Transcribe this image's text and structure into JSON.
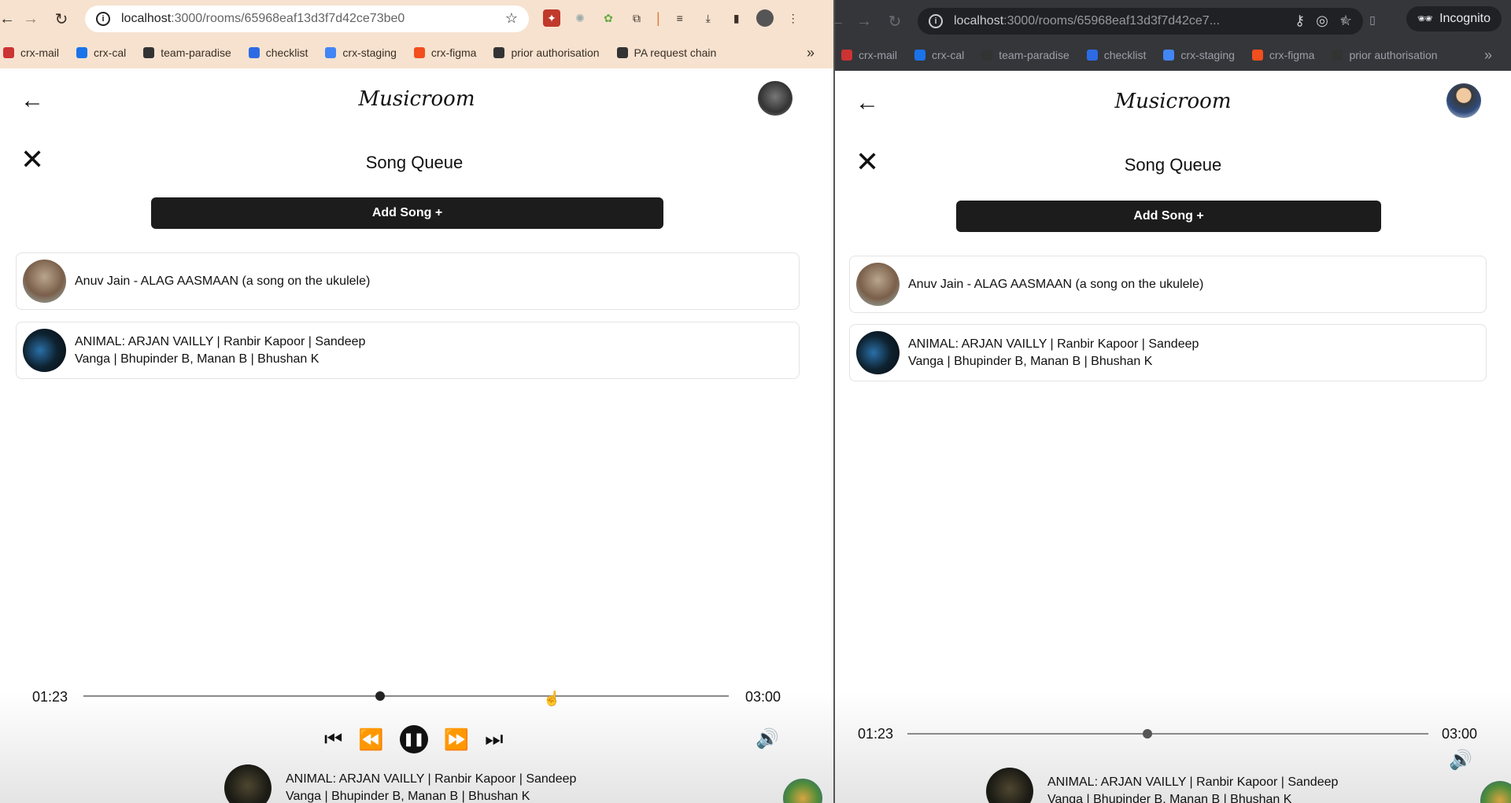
{
  "left_window": {
    "url_host": "localhost",
    "url_path": ":3000/rooms/65968eaf13d3f7d42ce73be0",
    "bookmarks": [
      "crx-mail",
      "crx-cal",
      "team-paradise",
      "checklist",
      "crx-staging",
      "crx-figma",
      "prior authorisation",
      "PA request chain"
    ],
    "app": {
      "brand": "Musicroom",
      "queue_title": "Song Queue",
      "add_song_label": "Add Song +",
      "queue": [
        {
          "title": "Anuv Jain - ALAG AASMAAN (a song on the ukulele)"
        },
        {
          "title": "ANIMAL: ARJAN VAILLY | Ranbir Kapoor | Sandeep Vanga | Bhupinder B, Manan B | Bhushan K"
        }
      ],
      "player": {
        "elapsed": "01:23",
        "duration": "03:00",
        "progress_fraction": 0.46,
        "now_playing": "ANIMAL: ARJAN VAILLY | Ranbir Kapoor | Sandeep Vanga | Bhupinder B, Manan B | Bhushan K"
      }
    }
  },
  "right_window": {
    "url_host": "localhost",
    "url_path": ":3000/rooms/65968eaf13d3f7d42ce7...",
    "incognito_label": "Incognito",
    "bookmarks": [
      "crx-mail",
      "crx-cal",
      "team-paradise",
      "checklist",
      "crx-staging",
      "crx-figma",
      "prior authorisation"
    ],
    "app": {
      "brand": "Musicroom",
      "queue_title": "Song Queue",
      "add_song_label": "Add Song +",
      "queue": [
        {
          "title": "Anuv Jain - ALAG AASMAAN (a song on the ukulele)"
        },
        {
          "title": "ANIMAL: ARJAN VAILLY | Ranbir Kapoor | Sandeep Vanga | Bhupinder B, Manan B | Bhushan K"
        }
      ],
      "player": {
        "elapsed": "01:23",
        "duration": "03:00",
        "progress_fraction": 0.46,
        "now_playing": "ANIMAL: ARJAN VAILLY | Ranbir Kapoor | Sandeep Vanga | Bhupinder B, Manan B | Bhushan K"
      }
    }
  },
  "colors": {
    "left_chrome": "#f6e2cf",
    "right_chrome": "#35363a",
    "button_dark": "#1c1c1c"
  }
}
